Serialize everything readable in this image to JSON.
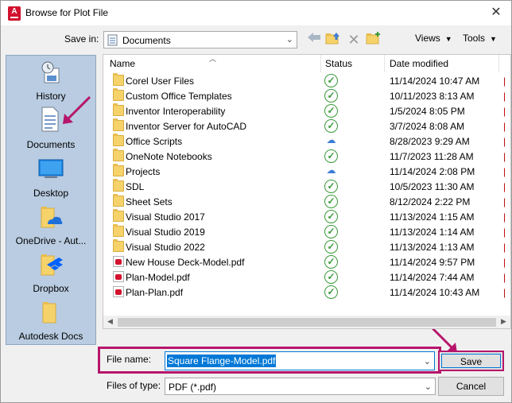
{
  "window": {
    "title": "Browse for Plot File",
    "close_glyph": "✕"
  },
  "toolbar": {
    "save_in_label": "Save in:",
    "save_in_value": "Documents",
    "views_label": "Views",
    "tools_label": "Tools"
  },
  "places": [
    {
      "label": "History",
      "icon": "history-icon"
    },
    {
      "label": "Documents",
      "icon": "documents-icon"
    },
    {
      "label": "Desktop",
      "icon": "desktop-icon"
    },
    {
      "label": "OneDrive - Aut...",
      "icon": "onedrive-icon"
    },
    {
      "label": "Dropbox",
      "icon": "dropbox-icon"
    },
    {
      "label": "Autodesk Docs",
      "icon": "autodesk-docs-icon"
    }
  ],
  "columns": {
    "name": "Name",
    "status": "Status",
    "date": "Date modified"
  },
  "files": [
    {
      "name": "Corel User Files",
      "type": "folder",
      "status": "synced",
      "date": "11/14/2024 10:47 AM"
    },
    {
      "name": "Custom Office Templates",
      "type": "folder",
      "status": "synced",
      "date": "10/11/2023 8:13 AM"
    },
    {
      "name": "Inventor Interoperability",
      "type": "folder",
      "status": "synced",
      "date": "1/5/2024 8:05 PM"
    },
    {
      "name": "Inventor Server for AutoCAD",
      "type": "folder",
      "status": "synced",
      "date": "3/7/2024 8:08 AM"
    },
    {
      "name": "Office Scripts",
      "type": "folder",
      "status": "cloud",
      "date": "8/28/2023 9:29 AM"
    },
    {
      "name": "OneNote Notebooks",
      "type": "folder",
      "status": "synced",
      "date": "11/7/2023 11:28 AM"
    },
    {
      "name": "Projects",
      "type": "folder",
      "status": "cloud",
      "date": "11/14/2024 2:08 PM"
    },
    {
      "name": "SDL",
      "type": "folder",
      "status": "synced",
      "date": "10/5/2023 11:30 AM"
    },
    {
      "name": "Sheet Sets",
      "type": "folder",
      "status": "synced",
      "date": "8/12/2024 2:22 PM"
    },
    {
      "name": "Visual Studio 2017",
      "type": "folder",
      "status": "synced",
      "date": "11/13/2024 1:15 AM"
    },
    {
      "name": "Visual Studio 2019",
      "type": "folder",
      "status": "synced",
      "date": "11/13/2024 1:14 AM"
    },
    {
      "name": "Visual Studio 2022",
      "type": "folder",
      "status": "synced",
      "date": "11/13/2024 1:13 AM"
    },
    {
      "name": "New House Deck-Model.pdf",
      "type": "pdf",
      "status": "synced",
      "date": "11/14/2024 9:57 PM"
    },
    {
      "name": "Plan-Model.pdf",
      "type": "pdf",
      "status": "synced",
      "date": "11/14/2024 7:44 AM"
    },
    {
      "name": "Plan-Plan.pdf",
      "type": "pdf",
      "status": "synced",
      "date": "11/14/2024 10:43 AM"
    }
  ],
  "file_name": {
    "label": "File name:",
    "value": "Square Flange-Model.pdf"
  },
  "file_type": {
    "label": "Files of type:",
    "value": "PDF (*.pdf)"
  },
  "buttons": {
    "save": "Save",
    "cancel": "Cancel"
  },
  "colors": {
    "accent": "#0078d7",
    "annotation": "#b6156b",
    "places_bg": "#b9cce1",
    "synced": "#3a9a3a",
    "cloud": "#3b7dd8"
  }
}
